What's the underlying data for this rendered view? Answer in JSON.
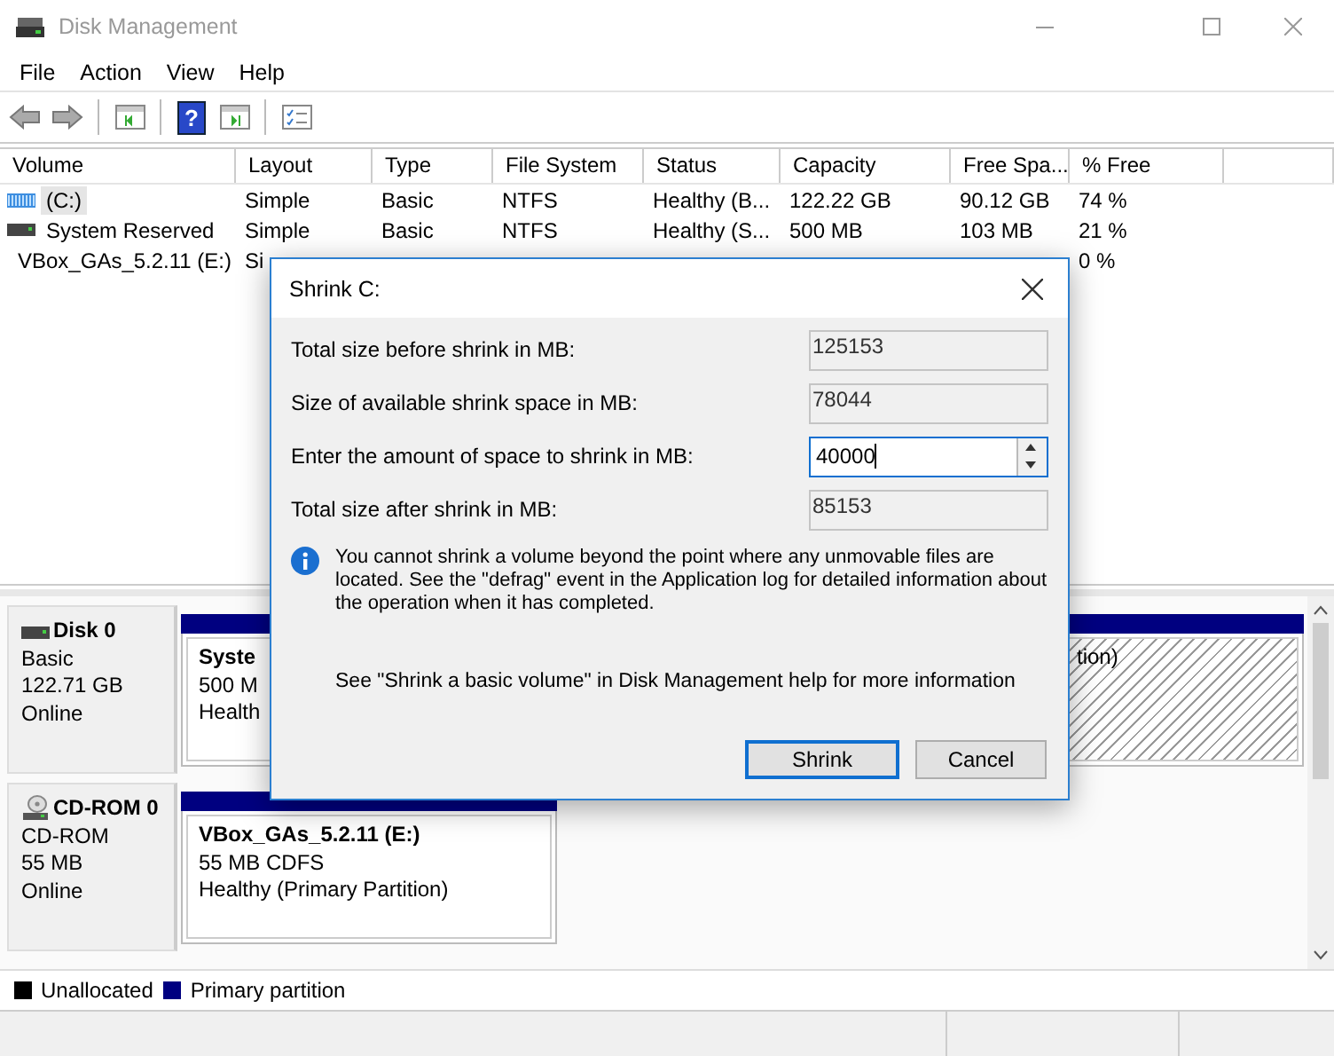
{
  "window": {
    "title": "Disk Management"
  },
  "menu": [
    "File",
    "Action",
    "View",
    "Help"
  ],
  "toolbar": [
    {
      "kind": "back"
    },
    {
      "kind": "forward"
    },
    {
      "kind": "panel"
    },
    {
      "kind": "help",
      "glyph": "?"
    },
    {
      "kind": "run"
    },
    {
      "kind": "list"
    }
  ],
  "volume_table": {
    "columns": [
      "Volume",
      "Layout",
      "Type",
      "File System",
      "Status",
      "Capacity",
      "Free Spa...",
      "% Free"
    ],
    "rows": [
      {
        "kind": "drive",
        "selected": true,
        "volume": "(C:)",
        "layout": "Simple",
        "type": "Basic",
        "file_system": "NTFS",
        "status": "Healthy (B...",
        "capacity": "122.22 GB",
        "free_space": "90.12 GB",
        "percent_free": "74 %"
      },
      {
        "kind": "drive",
        "selected": false,
        "volume": "System Reserved",
        "layout": "Simple",
        "type": "Basic",
        "file_system": "NTFS",
        "status": "Healthy (S...",
        "capacity": "500 MB",
        "free_space": "103 MB",
        "percent_free": "21 %"
      },
      {
        "kind": "cd",
        "selected": false,
        "volume": "VBox_GAs_5.2.11 (E:)",
        "layout": "Si",
        "percent_free": "0 %"
      }
    ]
  },
  "disks": [
    {
      "kind": "disk",
      "name": "Disk 0",
      "type": "Basic",
      "size": "122.71 GB",
      "status": "Online",
      "partitions": [
        {
          "lines": [
            "Syste",
            "500 M",
            "Health"
          ],
          "selected": false
        },
        {
          "lines": [
            "tion)"
          ],
          "selected": true
        }
      ]
    },
    {
      "kind": "cdrom",
      "name": "CD-ROM 0",
      "type": "CD-ROM",
      "size": "55 MB",
      "status": "Online",
      "partitions": [
        {
          "lines": [
            "VBox_GAs_5.2.11  (E:)",
            "55 MB CDFS",
            "Healthy (Primary Partition)"
          ],
          "selected": false
        }
      ]
    }
  ],
  "legend": [
    {
      "label": "Unallocated",
      "color": "#000000"
    },
    {
      "label": "Primary partition",
      "color": "#000080"
    }
  ],
  "dialog": {
    "title": "Shrink C:",
    "fields": [
      {
        "label": "Total size before shrink in MB:",
        "value": "125153",
        "kind": "readonly",
        "focused": false
      },
      {
        "label": "Size of available shrink space in MB:",
        "value": "78044",
        "kind": "readonly",
        "focused": false
      },
      {
        "label": "Enter the amount of space to shrink in MB:",
        "value": "40000",
        "kind": "spin",
        "focused": true
      },
      {
        "label": "Total size after shrink in MB:",
        "value": "85153",
        "kind": "readonly",
        "focused": false
      }
    ],
    "info": "You cannot shrink a volume beyond the point where any unmovable files are located. See the \"defrag\" event in the Application log for detailed information about the operation when it has completed.",
    "help": "See \"Shrink a basic volume\" in Disk Management help for more information",
    "buttons": [
      {
        "label": "Shrink",
        "default": true
      },
      {
        "label": "Cancel",
        "default": false
      }
    ]
  }
}
